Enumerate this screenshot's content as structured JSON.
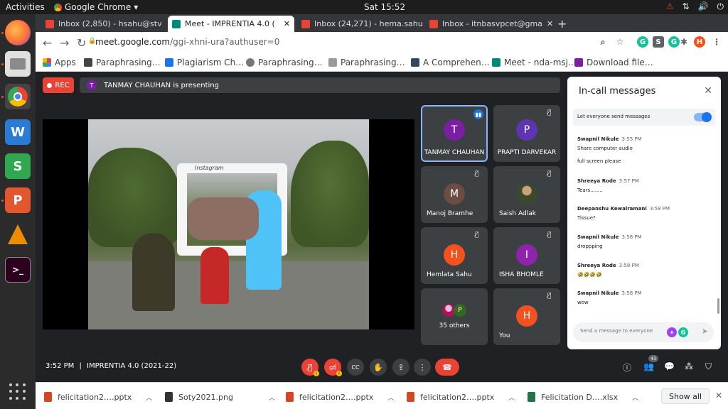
{
  "topbar": {
    "activities": "Activities",
    "app": "Google Chrome",
    "app_caret": "▾",
    "clock": "Sat 15:52",
    "tray": [
      "⚠",
      "⇅",
      "🔊",
      "⏻"
    ]
  },
  "dock": {
    "apps": [
      "firefox",
      "files",
      "chrome",
      "writer",
      "calc",
      "impress",
      "vlc",
      "terminal"
    ]
  },
  "chrome": {
    "tabs": [
      {
        "label": "Inbox (2,850) - hsahu@stv",
        "icon_color": "#ea4335"
      },
      {
        "label": "Meet - IMPRENTIA 4.0 (",
        "icon_color": "#00897b"
      },
      {
        "label": "Inbox (24,271) - hema.sahu",
        "icon_color": "#ea4335"
      },
      {
        "label": "Inbox - itnbasvpcet@gma",
        "icon_color": "#ea4335"
      }
    ],
    "new_tab": "+",
    "url": "meet.google.com",
    "url_path": "/ggi-xhni-ura?authuser=0",
    "bookmarks": [
      {
        "label": "Apps",
        "color": "#ea4335"
      },
      {
        "label": "Paraphrasing…",
        "color": "#3c4043"
      },
      {
        "label": "Plagiarism Ch…",
        "color": "#1a73e8"
      },
      {
        "label": "Paraphrasing…",
        "color": "#5f6368"
      },
      {
        "label": "Paraphrasing…",
        "color": "#5f6368"
      },
      {
        "label": "A Comprehen…",
        "color": "#34495e"
      },
      {
        "label": "Meet - nda-msj…",
        "color": "#00897b"
      },
      {
        "label": "Download file…",
        "color": "#7b1fa2"
      }
    ],
    "profile_letter": "H"
  },
  "meet": {
    "rec": "REC",
    "presenter_initial": "T",
    "presenting": "TANMAY CHAUHAN is presenting",
    "frame_title": "Instagram",
    "tiles": [
      {
        "initial": "T",
        "name": "TANMAY CHAUHAN",
        "color": "#7b1fa2"
      },
      {
        "initial": "P",
        "name": "PRAPTI DARVEKAR",
        "color": "#5e35b1"
      },
      {
        "initial": "M",
        "name": "Manoj Bramhe",
        "color": "#6d4c41"
      },
      {
        "initial": "",
        "name": "Saish Adlak",
        "color": "#3a4a2a"
      },
      {
        "initial": "H",
        "name": "Hemlata Sahu",
        "color": "#f4511e"
      },
      {
        "initial": "I",
        "name": "ISHA BHOMLE",
        "color": "#8e24aa"
      },
      {
        "initial": "P",
        "name": "35 others",
        "color": "#33691e"
      },
      {
        "initial": "H",
        "name": "You",
        "color": "#f4511e"
      }
    ],
    "meeting_time": "3:52 PM",
    "meeting_sep": "|",
    "meeting_name": "IMPRENTIA 4.0 (2021-22)",
    "people_count": "43"
  },
  "chat": {
    "title": "In-call messages",
    "toggle_label": "Let everyone send messages",
    "messages": [
      {
        "who": "Swapnil Nikule",
        "time": "3:55 PM",
        "text": "Share computer audio",
        "text2": "full screen please"
      },
      {
        "who": "Shreeya Rode",
        "time": "3:57 PM",
        "text": "Tears........"
      },
      {
        "who": "Deepanshu Kewalramani",
        "time": "3:58 PM",
        "text": "Tissue?"
      },
      {
        "who": "Swapnil Nikule",
        "time": "3:58 PM",
        "text": "droppping"
      },
      {
        "who": "Shreeya Rode",
        "time": "3:58 PM",
        "text": "🤣🤣🤣🤣"
      },
      {
        "who": "Swapnil Nikule",
        "time": "3:58 PM",
        "text": "wow"
      }
    ],
    "placeholder": "Send a message to everyone"
  },
  "downloads": {
    "items": [
      {
        "label": "felicitation2….pptx",
        "color": "#d24726"
      },
      {
        "label": "Soty2021.png",
        "color": "#333333"
      },
      {
        "label": "felicitation2….pptx",
        "color": "#d24726"
      },
      {
        "label": "felicitation2….pptx",
        "color": "#d24726"
      },
      {
        "label": "Felicitation D….xlsx",
        "color": "#217346"
      }
    ],
    "show_all": "Show all",
    "close": "✕"
  }
}
